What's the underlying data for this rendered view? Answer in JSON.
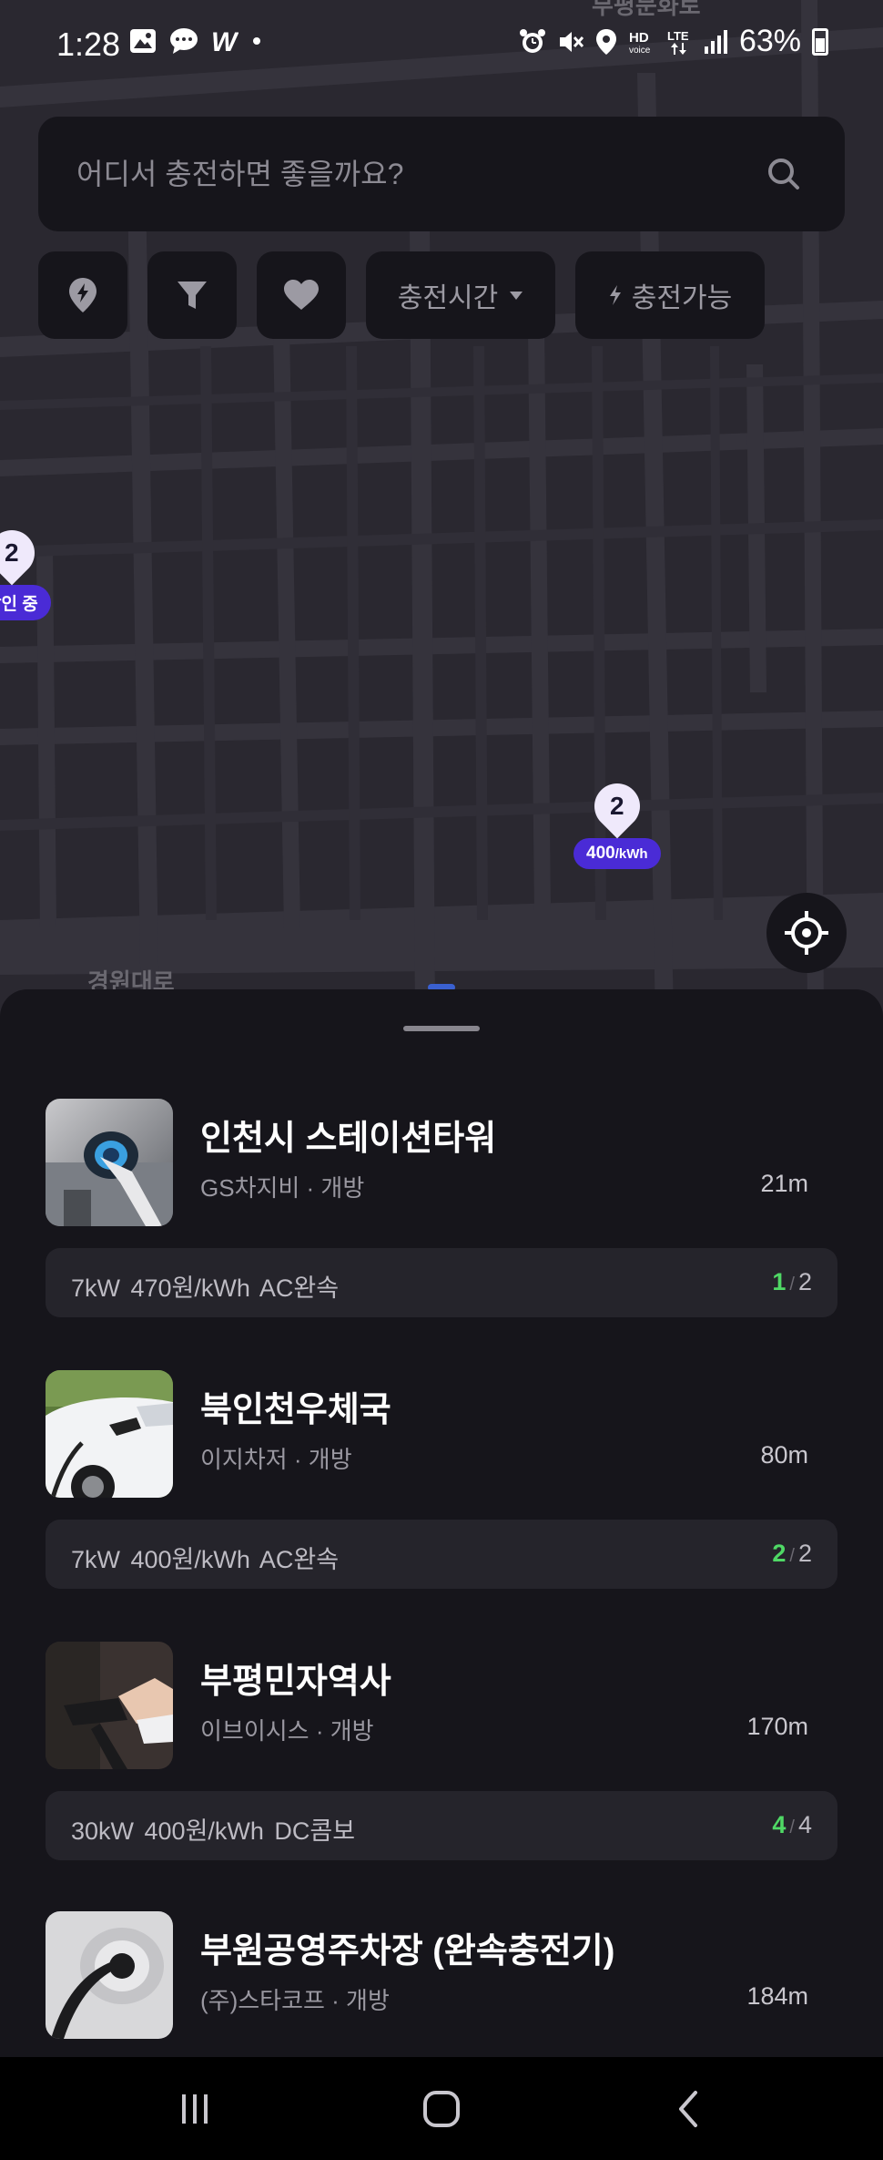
{
  "status_bar": {
    "time": "1:28",
    "battery": "63%"
  },
  "map": {
    "top_label": "부평문화로",
    "road_label": "경원대로",
    "markers": [
      {
        "count": "2",
        "label": "할인 중"
      },
      {
        "count": "2",
        "price": "400",
        "unit": "/kWh"
      }
    ]
  },
  "search": {
    "placeholder": "어디서 충전하면 좋을까요?"
  },
  "filters": {
    "charge_time": "충전시간",
    "available": "충전가능"
  },
  "stations": [
    {
      "name": "인천시 스테이션타워",
      "operator": "GS차지비",
      "status": "개방",
      "subtitle": "GS차지비 · 개방",
      "distance": "21m",
      "spec": "7kW  470원/kWh  AC완속",
      "available": "1",
      "total": "2"
    },
    {
      "name": "북인천우체국",
      "operator": "이지차저",
      "status": "개방",
      "subtitle": "이지차저 · 개방",
      "distance": "80m",
      "spec": "7kW  400원/kWh  AC완속",
      "available": "2",
      "total": "2"
    },
    {
      "name": "부평민자역사",
      "operator": "이브이시스",
      "status": "개방",
      "subtitle": "이브이시스 · 개방",
      "distance": "170m",
      "spec": "30kW  400원/kWh  DC콤보",
      "available": "4",
      "total": "4"
    },
    {
      "name": "부원공영주차장 (완속충전기)",
      "operator": "(주)스타코프",
      "status": "개방",
      "subtitle": "(주)스타코프 · 개방",
      "distance": "184m"
    }
  ],
  "colors": {
    "accent": "#4a2bd6",
    "available": "#4fd865",
    "background": "#16151b",
    "map": "#2a2830"
  }
}
